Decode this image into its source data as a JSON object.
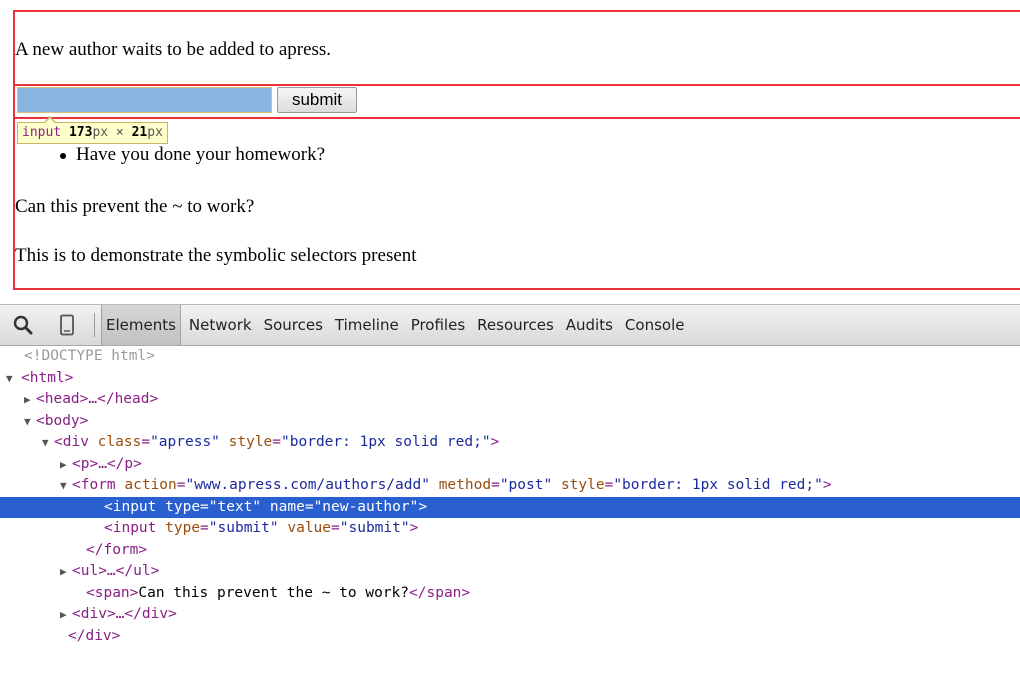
{
  "page": {
    "intro_text": "A new author waits to be added to apress.",
    "submit_label": "submit",
    "tooltip": {
      "tag": "input",
      "width_value": "173",
      "width_unit": "px",
      "times": " × ",
      "height_value": "21",
      "height_unit": "px"
    },
    "bullet": "Have you done your homework?",
    "span_text": "Can this prevent the ~ to work?",
    "last_text": "This is to demonstrate the symbolic selectors present",
    "border_color": "#e8313a"
  },
  "devtools": {
    "tabs": [
      {
        "label": "Elements",
        "active": true
      },
      {
        "label": "Network",
        "active": false
      },
      {
        "label": "Sources",
        "active": false
      },
      {
        "label": "Timeline",
        "active": false
      },
      {
        "label": "Profiles",
        "active": false
      },
      {
        "label": "Resources",
        "active": false
      },
      {
        "label": "Audits",
        "active": false
      },
      {
        "label": "Console",
        "active": false
      }
    ],
    "icons": [
      "search-icon",
      "device-mode-icon"
    ],
    "selection_color": "#2a5fd0",
    "lines": [
      {
        "doctype": "<!DOCTYPE html>"
      },
      {
        "open": "<",
        "tag": "html",
        "close": ">"
      },
      {
        "open": "<",
        "tag": "head",
        "mid": ">…</",
        "tag2": "head",
        "close": ">"
      },
      {
        "open": "<",
        "tag": "body",
        "close": ">"
      },
      {
        "open": "<",
        "tag": "div",
        "a1": "class",
        "v1": "\"apress\"",
        "a2": "style",
        "v2": "\"border: 1px solid red;\"",
        "close": ">"
      },
      {
        "open": "<",
        "tag": "p",
        "mid": ">…</",
        "tag2": "p",
        "close": ">"
      },
      {
        "open": "<",
        "tag": "form",
        "a1": "action",
        "v1": "\"www.apress.com/authors/add\"",
        "a2": "method",
        "v2": "\"post\"",
        "a3": "style",
        "v3": "\"border: 1px solid red;\"",
        "close": ">"
      },
      {
        "open": "<",
        "tag": "input",
        "a1": "type",
        "v1": "\"text\"",
        "a2": "name",
        "v2": "\"new-author\"",
        "close": ">"
      },
      {
        "open": "<",
        "tag": "input",
        "a1": "type",
        "v1": "\"submit\"",
        "a2": "value",
        "v2": "\"submit\"",
        "close": ">"
      },
      {
        "open": "</",
        "tag": "form",
        "close": ">"
      },
      {
        "open": "<",
        "tag": "ul",
        "mid": ">…</",
        "tag2": "ul",
        "close": ">"
      },
      {
        "open": "<",
        "tag": "span",
        "mid": ">",
        "text": "Can this prevent the ~ to work?",
        "mid2": "</",
        "tag2": "span",
        "close": ">"
      },
      {
        "open": "<",
        "tag": "div",
        "mid": ">…</",
        "tag2": "div",
        "close": ">"
      },
      {
        "open": "</",
        "tag": "div",
        "close": ">"
      }
    ]
  }
}
